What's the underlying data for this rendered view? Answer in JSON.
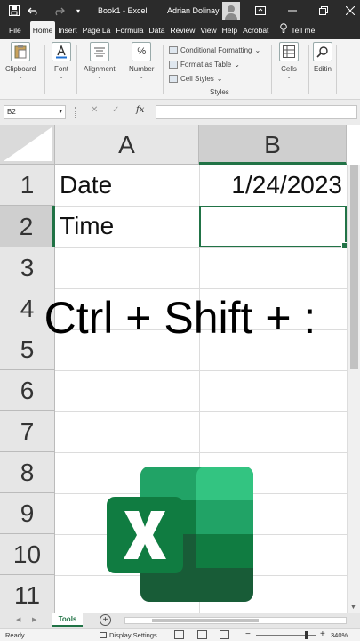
{
  "titlebar": {
    "title": "Book1 - Excel",
    "user": "Adrian Dolinay"
  },
  "tabs": [
    "File",
    "Home",
    "Insert",
    "Page La",
    "Formula",
    "Data",
    "Review",
    "View",
    "Help",
    "Acrobat"
  ],
  "tell_me": "Tell me",
  "ribbon": {
    "clipboard": "Clipboard",
    "font": "Font",
    "alignment": "Alignment",
    "number": "Number",
    "number_symbol": "%",
    "conditional_formatting": "Conditional Formatting",
    "format_as_table": "Format as Table",
    "cell_styles": "Cell Styles",
    "styles_group": "Styles",
    "cells": "Cells",
    "editing": "Editin"
  },
  "formula_bar": {
    "name_box": "B2",
    "fx": "fx",
    "content": ""
  },
  "grid": {
    "columns": [
      "A",
      "B"
    ],
    "rows": [
      "1",
      "2",
      "3",
      "4",
      "5",
      "6",
      "7",
      "8",
      "9",
      "10",
      "11"
    ],
    "cells": {
      "A1": "Date",
      "B1": "1/24/2023",
      "A2": "Time",
      "B2": ""
    },
    "selected_cell": "B2"
  },
  "overlay_text": "Ctrl + Shift + :",
  "logo": "excel-logo",
  "sheet_tabs": [
    "Tools"
  ],
  "status": {
    "ready": "Ready",
    "display_settings": "Display Settings",
    "zoom": "340%"
  },
  "colors": {
    "title_bar": "#2b2b2b",
    "excel_green": "#217346"
  }
}
